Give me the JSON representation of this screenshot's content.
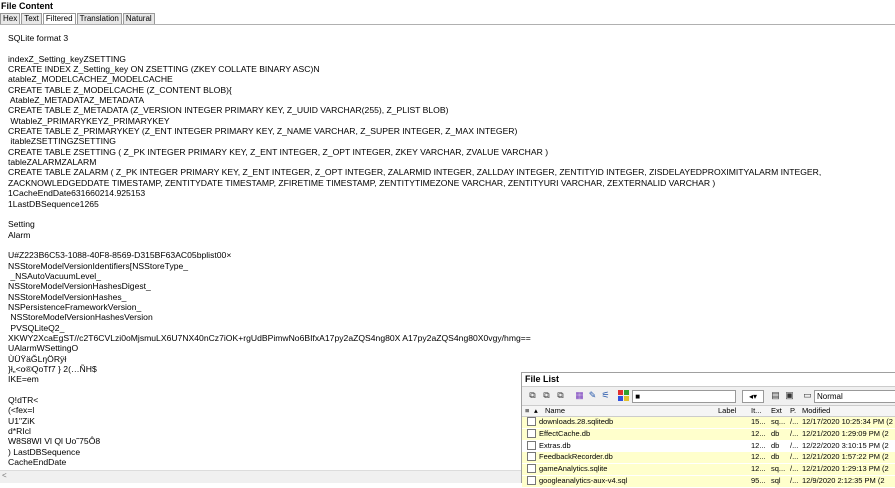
{
  "header": {
    "title": "File Content"
  },
  "tabs": [
    "Hex",
    "Text",
    "Filtered",
    "Translation",
    "Natural"
  ],
  "content_lines": [
    "SQLite format 3",
    "",
    "indexZ_Setting_keyZSETTING",
    "CREATE INDEX Z_Setting_key ON ZSETTING (ZKEY COLLATE BINARY ASC)N",
    "atableZ_MODELCACHEZ_MODELCACHE",
    "CREATE TABLE Z_MODELCACHE (Z_CONTENT BLOB){",
    " AtableZ_METADATAZ_METADATA",
    "CREATE TABLE Z_METADATA (Z_VERSION INTEGER PRIMARY KEY, Z_UUID VARCHAR(255), Z_PLIST BLOB)",
    " WtableZ_PRIMARYKEYZ_PRIMARYKEY",
    "CREATE TABLE Z_PRIMARYKEY (Z_ENT INTEGER PRIMARY KEY, Z_NAME VARCHAR, Z_SUPER INTEGER, Z_MAX INTEGER)",
    " itableZSETTINGZSETTING",
    "CREATE TABLE ZSETTING ( Z_PK INTEGER PRIMARY KEY, Z_ENT INTEGER, Z_OPT INTEGER, ZKEY VARCHAR, ZVALUE VARCHAR )",
    "tableZALARMZALARM",
    "CREATE TABLE ZALARM ( Z_PK INTEGER PRIMARY KEY, Z_ENT INTEGER, Z_OPT INTEGER, ZALARMID INTEGER, ZALLDAY INTEGER, ZENTITYID INTEGER, ZISDELAYEDPROXIMITYALARM INTEGER,",
    "ZACKNOWLEDGEDDATE TIMESTAMP, ZENTITYDATE TIMESTAMP, ZFIRETIME TIMESTAMP, ZENTITYTIMEZONE VARCHAR, ZENTITYURI VARCHAR, ZEXTERNALID VARCHAR )",
    "1CacheEndDate631660214.925153",
    "1LastDBSequence1265",
    "",
    "Setting",
    "Alarm",
    "",
    "U#Z223B6C53-1088-40F8-8569-D315BF63AC05bplist00×",
    "NSStoreModelVersionIdentifiers[NSStoreType_",
    " _NSAutoVacuumLevel_",
    "NSStoreModelVersionHashesDigest_",
    "NSStoreModelVersionHashes_",
    "NSPersistenceFrameworkVersion_",
    " NSStoreModelVersionHashesVersion",
    " PVSQLiteQ2_",
    "XKWY2XcaEgST//c2T6CVLzi0oMjsmuLX6U7NX40nCz7iOK+rgUdBPimwNo6BIfxA17py2aZQS4ng80X A17py2aZQS4ng80X0vgy/hmg==",
    "UAlarmWSettingO",
    "ÙÜŸäĞLŋÖRÿł",
    "}ł„<o®QoTf7 } 2(…ÑH$",
    "IKE=em",
    "",
    "Q!dTR<",
    "(<fex=l",
    "U1\"ZiK",
    "d*RIcl",
    "W8S8WI Vl Ql Uo˜75Ô8",
    ") LastDBSequence",
    "CacheEndDate"
  ],
  "file_list": {
    "title": "File List",
    "view_mode": "Normal",
    "columns": [
      "Name",
      "Label",
      "It...",
      "Ext",
      "P.",
      "Modified"
    ],
    "rows": [
      {
        "name": "downloads.28.sqlitedb",
        "label": "",
        "items": "15...",
        "ext": "sq...",
        "p": "/...",
        "modified": "12/17/2020 10:25:34 PM (2",
        "yellow": true
      },
      {
        "name": "EffectCache.db",
        "label": "",
        "items": "12...",
        "ext": "db",
        "p": "/...",
        "modified": "12/21/2020 1:29:09 PM (2",
        "yellow": true
      },
      {
        "name": "Extras.db",
        "label": "",
        "items": "12...",
        "ext": "db",
        "p": "/...",
        "modified": "12/22/2020 3:10:15 PM (2",
        "yellow": false
      },
      {
        "name": "FeedbackRecorder.db",
        "label": "",
        "items": "12...",
        "ext": "db",
        "p": "/...",
        "modified": "12/21/2020 1:57:22 PM (2",
        "yellow": true
      },
      {
        "name": "gameAnalytics.sqlite",
        "label": "",
        "items": "12...",
        "ext": "sq...",
        "p": "/...",
        "modified": "12/21/2020 1:29:13 PM (2",
        "yellow": true
      },
      {
        "name": "googleanalytics-aux-v4.sql",
        "label": "",
        "items": "95...",
        "ext": "sql",
        "p": "/...",
        "modified": "12/9/2020 2:12:35 PM (2",
        "yellow": true
      }
    ]
  }
}
